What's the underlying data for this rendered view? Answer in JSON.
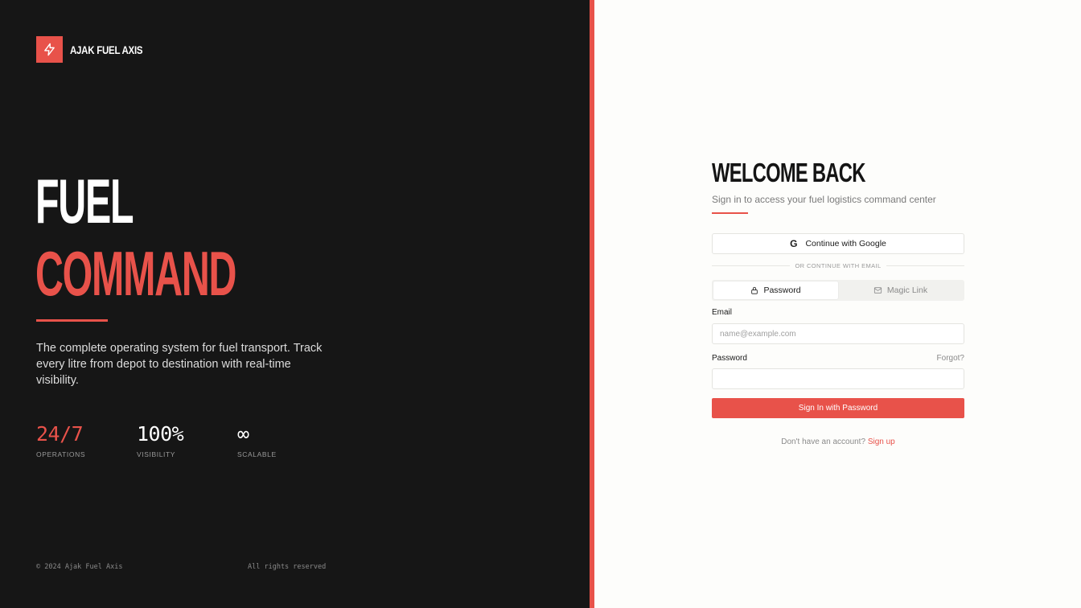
{
  "brand": {
    "name": "AJAK FUEL AXIS",
    "logo_icon": "bolt-icon"
  },
  "hero": {
    "line1": "FUEL",
    "line2": "COMMAND"
  },
  "description": "The complete operating system for fuel transport. Track every litre from depot to destination with real-time visibility.",
  "stats": [
    {
      "value": "24/7",
      "label": "OPERATIONS"
    },
    {
      "value": "100%",
      "label": "VISIBILITY"
    },
    {
      "value": "∞",
      "label": "SCALABLE"
    }
  ],
  "footer": {
    "copyright": "© 2024 Ajak Fuel Axis",
    "rights": "All rights reserved"
  },
  "form": {
    "title": "WELCOME BACK",
    "subtitle": "Sign in to access your fuel logistics command center",
    "google_label": "Continue with Google",
    "divider_text": "OR CONTINUE WITH EMAIL",
    "tabs": [
      {
        "label": "Password",
        "icon": "lock-icon",
        "active": true
      },
      {
        "label": "Magic Link",
        "icon": "mail-icon",
        "active": false
      }
    ],
    "email_label": "Email",
    "email_placeholder": "name@example.com",
    "email_value": "",
    "password_label": "Password",
    "forgot_label": "Forgot?",
    "password_value": "",
    "submit_label": "Sign In with Password",
    "signup_prompt": "Don't have an account?",
    "signup_link": "Sign up"
  },
  "colors": {
    "accent": "#e8524a",
    "dark_bg": "#161616",
    "light_bg": "#fdfdfb"
  }
}
